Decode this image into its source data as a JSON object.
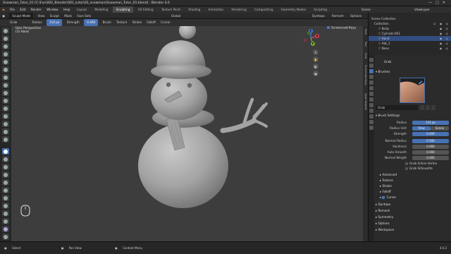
{
  "window": {
    "title": "Snowman_Tutor_01 [C:\\Fun\\002_Blender\\001_tutor\\03_snowman\\Snowman_Tutor_01.blend] - Blender 4.0"
  },
  "menu": {
    "items": [
      "File",
      "Edit",
      "Render",
      "Window",
      "Help"
    ],
    "workspaces": [
      "Layout",
      "Modeling",
      "Sculpting",
      "UV Editing",
      "Texture Paint",
      "Shading",
      "Animation",
      "Rendering",
      "Compositing",
      "Geometry Nodes",
      "Scripting"
    ],
    "active_workspace": "Sculpting",
    "scene": "Scene",
    "view_layer": "ViewLayer"
  },
  "header": {
    "mode": "Sculpt Mode",
    "items": [
      "View",
      "Sculpt",
      "Mask",
      "Face Sets"
    ],
    "transform": "Global",
    "right_items": [
      "Dyntopo",
      "Remesh",
      "Options"
    ]
  },
  "tool_header": {
    "tool": "Grab",
    "radius_label": "Radius",
    "radius_value": "114 px",
    "strength_label": "Strength",
    "strength_value": "0.400",
    "menus": [
      "Brush",
      "Texture",
      "Stroke",
      "Falloff",
      "Cursor"
    ]
  },
  "viewport": {
    "view_name": "User Perspective",
    "object_label": "(3) Hand",
    "screencast_label": "Screencast Keys",
    "gizmo_axes": [
      "X",
      "Y",
      "Z"
    ]
  },
  "sidebar_tabs": [
    "Item",
    "Tool",
    "View",
    "Screencast Keys",
    "Quad Remesh"
  ],
  "outliner": {
    "rows": [
      {
        "label": "Scene Collection",
        "selected": false
      },
      {
        "label": "Collection",
        "selected": false
      },
      {
        "label": "Body",
        "selected": false
      },
      {
        "label": "Cylinder.001",
        "selected": false
      },
      {
        "label": "Hand",
        "selected": true
      },
      {
        "label": "Hat_1",
        "selected": false
      },
      {
        "label": "Nose",
        "selected": false
      }
    ]
  },
  "properties": {
    "tool_name": "Grab",
    "brushes_label": "Brushes",
    "brush_name": "Grab",
    "brush_settings_label": "Brush Settings",
    "radius": {
      "label": "Radius",
      "value": "114 px"
    },
    "radius_unit": {
      "label": "Radius Unit",
      "options": [
        "View",
        "Scene"
      ],
      "selected": "View"
    },
    "strength": {
      "label": "Strength",
      "value": "0.400"
    },
    "normal_radius": {
      "label": "Normal Radius",
      "value": "0.500"
    },
    "hardness": {
      "label": "Hardness",
      "value": "0.000"
    },
    "auto_smooth": {
      "label": "Auto Smooth",
      "value": "0.000"
    },
    "normal_weight": {
      "label": "Normal Weight",
      "value": "0.000"
    },
    "checkboxes": [
      {
        "label": "Grab Active Vertex",
        "checked": false
      },
      {
        "label": "Grab Silhouette",
        "checked": false
      }
    ],
    "subsections": [
      "Advanced",
      "Texture",
      "Stroke",
      "Falloff",
      "Cursor"
    ],
    "cursor_checked": true,
    "sections": [
      "Dyntopo",
      "Remesh",
      "Symmetry",
      "Options",
      "Workspace"
    ]
  },
  "status_bar": {
    "items": [
      "Select",
      "Pan View",
      "Context Menu"
    ],
    "version": "4.0.2"
  },
  "colors": {
    "accent": "#4772b3",
    "viewport_bg": "#3d3d3d",
    "clay": "#a9a9a9",
    "brush_preview": "#c98f72"
  }
}
